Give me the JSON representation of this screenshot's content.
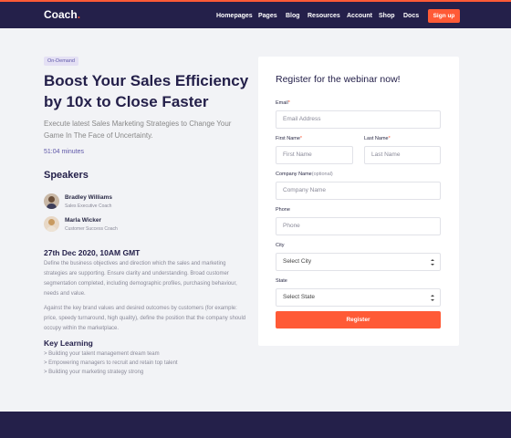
{
  "header": {
    "logo": "Coach",
    "logo_dot": ".",
    "nav": [
      "Homepages",
      "Pages",
      "Blog",
      "Resources",
      "Account",
      "Shop",
      "Docs"
    ],
    "signup_label": "Sign up"
  },
  "hero": {
    "badge": "On-Demand",
    "title": "Boost Your Sales Efficiency by 10x to Close Faster",
    "subtitle": "Execute latest Sales Marketing Strategies to Change Your Game In The Face of Uncertainty.",
    "duration": "51:04 minutes"
  },
  "speakers": {
    "title": "Speakers",
    "items": [
      {
        "name": "Bradley Williams",
        "role": "Sales Executive Coach"
      },
      {
        "name": "Marla Wicker",
        "role": "Customer Success Coach"
      }
    ]
  },
  "details": {
    "date": "27th Dec 2020, 10AM GMT",
    "paragraphs": [
      "Define the business objectives and direction which the sales and marketing strategies are supporting. Ensure clarity and understanding. Broad customer segmentation completed, including demographic profiles, purchasing behaviour, needs and value.",
      "Against the key brand values and desired outcomes by customers (for example: price, speedy turnaround, high quality), define the position that the company should occupy within the marketplace."
    ],
    "key_learning_title": "Key Learning",
    "key_learning": [
      "> Building your talent management dream team",
      "> Empowering managers to recruit and retain top talent",
      "> Building your marketing strategy strong"
    ]
  },
  "form": {
    "title": "Register for the webinar now!",
    "email_label": "Email",
    "email_placeholder": "Email Address",
    "first_name_label": "First Name",
    "first_name_placeholder": "First Name",
    "last_name_label": "Last Name",
    "last_name_placeholder": "Last Name",
    "company_label": "Company Name",
    "company_optional": "(optional)",
    "company_placeholder": "Company Name",
    "phone_label": "Phone",
    "phone_placeholder": "Phone",
    "city_label": "City",
    "city_value": "Select City",
    "state_label": "State",
    "state_value": "Select State",
    "required_mark": "*",
    "submit_label": "Register"
  },
  "colors": {
    "navy": "#24204a",
    "accent": "#ff5a36",
    "badge_bg": "#e4e0f4",
    "purple_text": "#5f57a8",
    "page_bg": "#f2f3f6"
  }
}
